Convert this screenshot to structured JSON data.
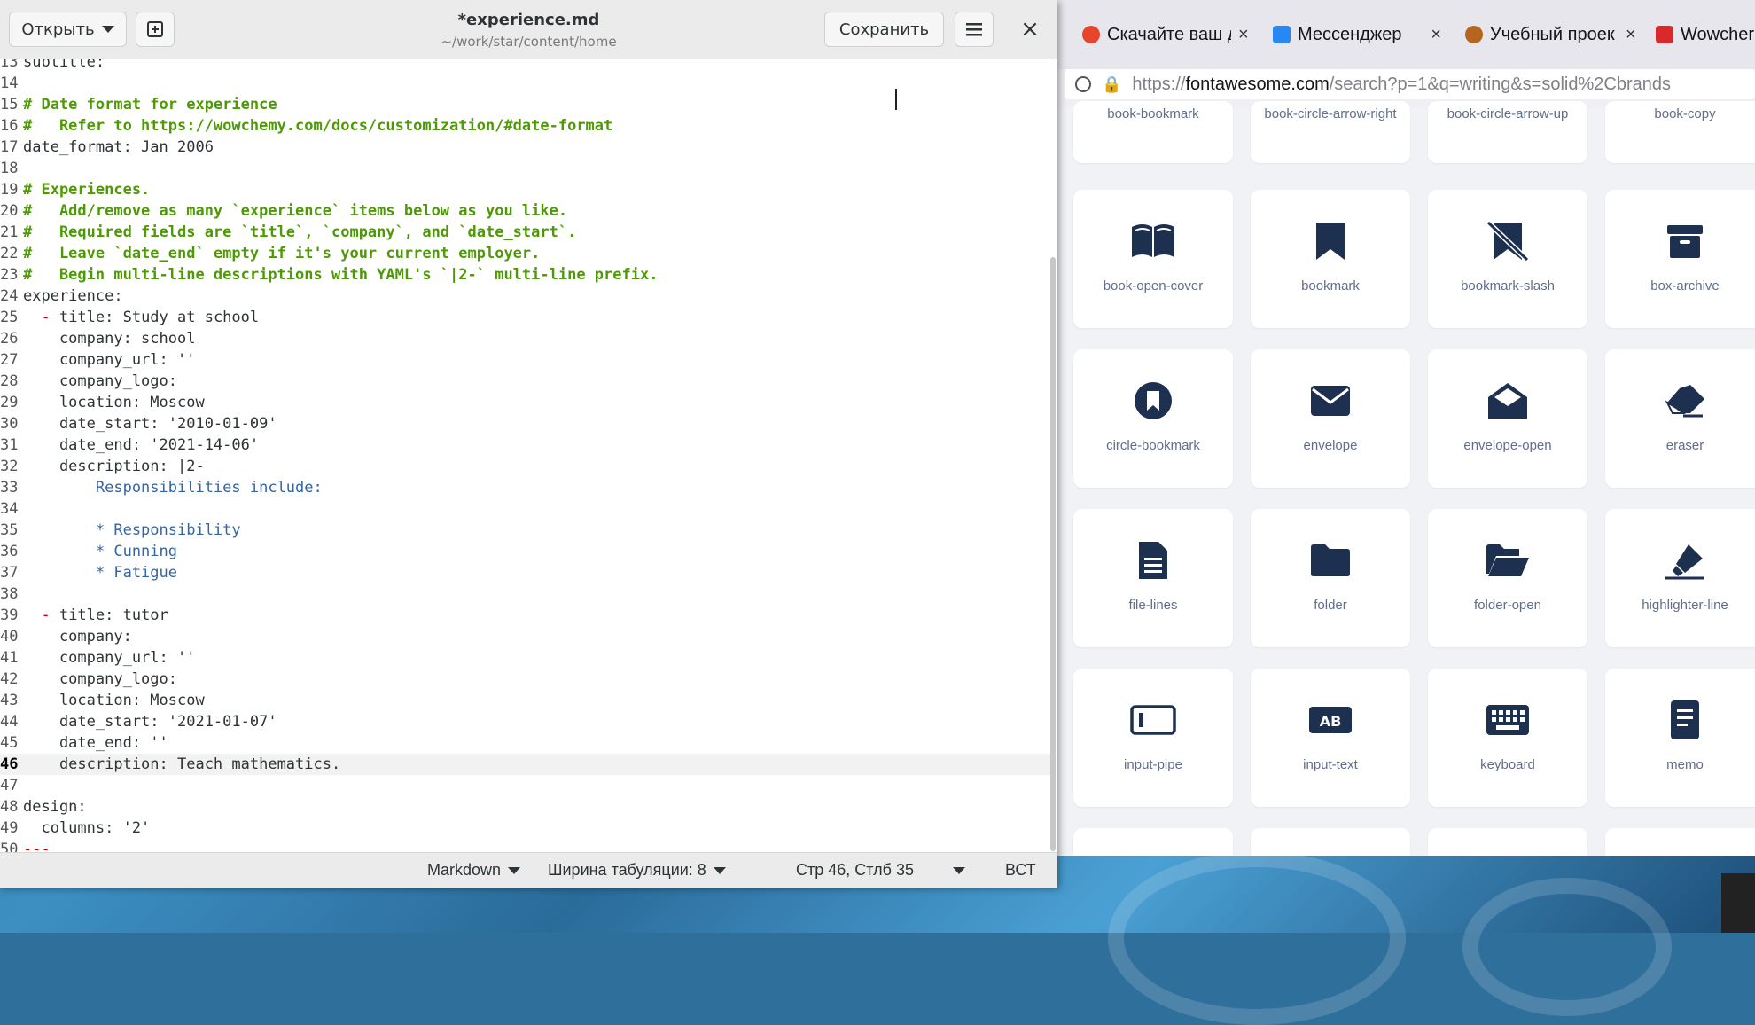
{
  "editor": {
    "open_label": "Открыть",
    "title": "*experience.md",
    "path": "~/work/star/content/home",
    "save_label": "Сохранить",
    "close_glyph": "×",
    "lines": [
      {
        "n": "13",
        "parts": [
          {
            "t": "subtitle:",
            "c": "c-text"
          }
        ]
      },
      {
        "n": "14",
        "parts": []
      },
      {
        "n": "15",
        "parts": [
          {
            "t": "# Date format for experience",
            "c": "c-comment"
          }
        ]
      },
      {
        "n": "16",
        "parts": [
          {
            "t": "#   Refer to https://wowchemy.com/docs/customization/#date-format",
            "c": "c-comment"
          }
        ]
      },
      {
        "n": "17",
        "parts": [
          {
            "t": "date_format: Jan 2006",
            "c": "c-text"
          }
        ]
      },
      {
        "n": "18",
        "parts": []
      },
      {
        "n": "19",
        "parts": [
          {
            "t": "# Experiences.",
            "c": "c-comment"
          }
        ]
      },
      {
        "n": "20",
        "parts": [
          {
            "t": "#   Add/remove as many `experience` items below as you like.",
            "c": "c-comment"
          }
        ]
      },
      {
        "n": "21",
        "parts": [
          {
            "t": "#   Required fields are `title`, `company`, and `date_start`.",
            "c": "c-comment"
          }
        ]
      },
      {
        "n": "22",
        "parts": [
          {
            "t": "#   Leave `date_end` empty if it's your current employer.",
            "c": "c-comment"
          }
        ]
      },
      {
        "n": "23",
        "parts": [
          {
            "t": "#   Begin multi-line descriptions with YAML's `|2-` multi-line prefix.",
            "c": "c-comment"
          }
        ]
      },
      {
        "n": "24",
        "parts": [
          {
            "t": "experience:",
            "c": "c-text"
          }
        ]
      },
      {
        "n": "25",
        "parts": [
          {
            "t": "  - ",
            "c": "c-red"
          },
          {
            "t": "title: Study at school",
            "c": "c-text"
          }
        ]
      },
      {
        "n": "26",
        "parts": [
          {
            "t": "    company: school",
            "c": "c-text"
          }
        ]
      },
      {
        "n": "27",
        "parts": [
          {
            "t": "    company_url: ''",
            "c": "c-text"
          }
        ]
      },
      {
        "n": "28",
        "parts": [
          {
            "t": "    company_logo:",
            "c": "c-text"
          }
        ]
      },
      {
        "n": "29",
        "parts": [
          {
            "t": "    location: Moscow",
            "c": "c-text"
          }
        ]
      },
      {
        "n": "30",
        "parts": [
          {
            "t": "    date_start: '2010-01-09'",
            "c": "c-text"
          }
        ]
      },
      {
        "n": "31",
        "parts": [
          {
            "t": "    date_end: '2021-14-06'",
            "c": "c-text"
          }
        ]
      },
      {
        "n": "32",
        "parts": [
          {
            "t": "    description: |2-",
            "c": "c-text"
          }
        ]
      },
      {
        "n": "33",
        "parts": [
          {
            "t": "        Responsibilities include:",
            "c": "c-blue"
          }
        ]
      },
      {
        "n": "34",
        "parts": []
      },
      {
        "n": "35",
        "parts": [
          {
            "t": "        * Responsibility",
            "c": "c-blue"
          }
        ]
      },
      {
        "n": "36",
        "parts": [
          {
            "t": "        * Cunning",
            "c": "c-blue"
          }
        ]
      },
      {
        "n": "37",
        "parts": [
          {
            "t": "        * Fatigue",
            "c": "c-blue"
          }
        ]
      },
      {
        "n": "38",
        "parts": []
      },
      {
        "n": "39",
        "parts": [
          {
            "t": "  - ",
            "c": "c-red"
          },
          {
            "t": "title: tutor",
            "c": "c-text"
          }
        ]
      },
      {
        "n": "40",
        "parts": [
          {
            "t": "    company:",
            "c": "c-text"
          }
        ]
      },
      {
        "n": "41",
        "parts": [
          {
            "t": "    company_url: ''",
            "c": "c-text"
          }
        ]
      },
      {
        "n": "42",
        "parts": [
          {
            "t": "    company_logo:",
            "c": "c-text"
          }
        ]
      },
      {
        "n": "43",
        "parts": [
          {
            "t": "    location: Moscow",
            "c": "c-text"
          }
        ]
      },
      {
        "n": "44",
        "parts": [
          {
            "t": "    date_start: '2021-01-07'",
            "c": "c-text"
          }
        ]
      },
      {
        "n": "45",
        "parts": [
          {
            "t": "    date_end: ''",
            "c": "c-text"
          }
        ]
      },
      {
        "n": "46",
        "parts": [
          {
            "t": "    description: Teach mathematics.",
            "c": "c-text"
          }
        ],
        "current": true
      },
      {
        "n": "47",
        "parts": []
      },
      {
        "n": "48",
        "parts": [
          {
            "t": "design:",
            "c": "c-text"
          }
        ]
      },
      {
        "n": "49",
        "parts": [
          {
            "t": "  columns: '2'",
            "c": "c-text"
          }
        ]
      },
      {
        "n": "50",
        "parts": [
          {
            "t": "---",
            "c": "c-red"
          }
        ]
      }
    ],
    "status": {
      "language": "Markdown",
      "tab_width": "Ширина табуляции: 8",
      "position": "Стр 46, Стлб 35",
      "mode": "ВСТ"
    }
  },
  "browser": {
    "tabs": [
      {
        "label": "Скачайте ваш д",
        "favicon_color": "#e8452c",
        "close": "×"
      },
      {
        "label": "Мессенджер",
        "favicon_color": "#2787f5",
        "close": "×"
      },
      {
        "label": "Учебный проек",
        "favicon_color": "#b5651d",
        "close": "×"
      },
      {
        "label": "Wowcher",
        "favicon_color": "#d9292b",
        "close": ""
      }
    ],
    "url_prefix": "https://",
    "url_domain": "fontawesome.com",
    "url_rest": "/search?p=1&q=writing&s=solid%2Cbrands",
    "icons_top": [
      "book-bookmark",
      "book-circle-arrow-right",
      "book-circle-arrow-up",
      "book-copy"
    ],
    "icons": [
      {
        "name": "book-open-cover",
        "icon": "book-open-icon"
      },
      {
        "name": "bookmark",
        "icon": "bookmark-icon"
      },
      {
        "name": "bookmark-slash",
        "icon": "bookmark-slash-icon"
      },
      {
        "name": "box-archive",
        "icon": "box-archive-icon"
      },
      {
        "name": "circle-bookmark",
        "icon": "circle-bookmark-icon"
      },
      {
        "name": "envelope",
        "icon": "envelope-icon"
      },
      {
        "name": "envelope-open",
        "icon": "envelope-open-icon"
      },
      {
        "name": "eraser",
        "icon": "eraser-icon"
      },
      {
        "name": "file-lines",
        "icon": "file-lines-icon"
      },
      {
        "name": "folder",
        "icon": "folder-icon"
      },
      {
        "name": "folder-open",
        "icon": "folder-open-icon"
      },
      {
        "name": "highlighter-line",
        "icon": "highlighter-icon"
      },
      {
        "name": "input-pipe",
        "icon": "input-pipe-icon"
      },
      {
        "name": "input-text",
        "icon": "input-text-icon"
      },
      {
        "name": "keyboard",
        "icon": "keyboard-icon"
      },
      {
        "name": "memo",
        "icon": "memo-icon"
      }
    ],
    "icon_color": "#1e3050"
  }
}
